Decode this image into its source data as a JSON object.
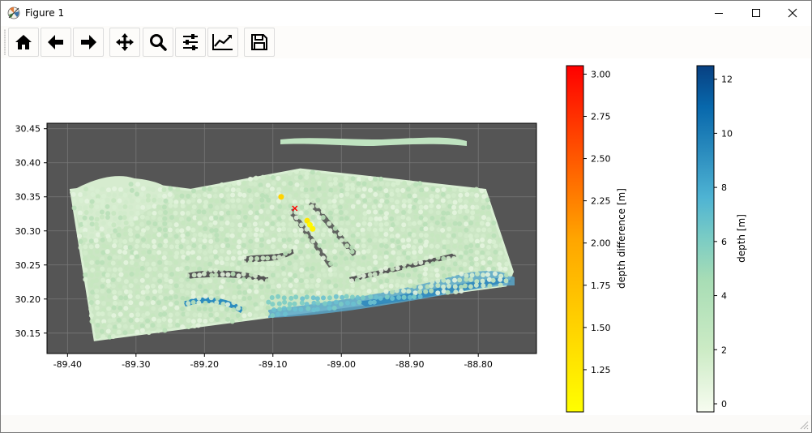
{
  "window": {
    "title": "Figure 1",
    "controls": [
      "minimize",
      "maximize",
      "close"
    ]
  },
  "toolbar": {
    "buttons": [
      {
        "name": "home",
        "icon": "home-icon"
      },
      {
        "name": "back",
        "icon": "arrow-left-icon"
      },
      {
        "name": "forward",
        "icon": "arrow-right-icon"
      },
      {
        "name": "pan",
        "icon": "move-icon"
      },
      {
        "name": "zoom",
        "icon": "magnifier-icon"
      },
      {
        "name": "configure-subplots",
        "icon": "sliders-icon"
      },
      {
        "name": "edit-axis",
        "icon": "line-chart-icon"
      },
      {
        "name": "save",
        "icon": "floppy-disk-icon"
      }
    ]
  },
  "chart_data": [
    {
      "type": "scatter",
      "title": "",
      "xlabel": "",
      "ylabel": "",
      "xlim": [
        -89.43,
        -88.715
      ],
      "ylim": [
        30.12,
        30.458
      ],
      "x_ticks": [
        -89.4,
        -89.3,
        -89.2,
        -89.1,
        -89.0,
        -88.9,
        -88.8
      ],
      "x_tick_labels": [
        "-89.40",
        "-89.30",
        "-89.20",
        "-89.10",
        "-89.00",
        "-88.90",
        "-88.80"
      ],
      "y_ticks": [
        30.15,
        30.2,
        30.25,
        30.3,
        30.35,
        30.4,
        30.45
      ],
      "y_tick_labels": [
        "30.15",
        "30.20",
        "30.25",
        "30.30",
        "30.35",
        "30.40",
        "30.45"
      ],
      "grid": true,
      "background": "#555555",
      "survey_region": {
        "outline": [
          [
            -89.395,
            30.36
          ],
          [
            -89.36,
            30.14
          ],
          [
            -88.76,
            30.22
          ],
          [
            -88.75,
            30.24
          ],
          [
            -88.79,
            30.36
          ],
          [
            -89.06,
            30.39
          ],
          [
            -89.22,
            30.36
          ],
          [
            -89.3,
            30.37
          ]
        ],
        "depth_range": [
          0,
          12
        ]
      },
      "difference_points": [
        {
          "x": -89.05,
          "y": 30.315,
          "value": 1.2
        },
        {
          "x": -89.046,
          "y": 30.309,
          "value": 1.05
        },
        {
          "x": -89.042,
          "y": 30.303,
          "value": 1.1
        },
        {
          "x": -89.088,
          "y": 30.35,
          "value": 1.35
        }
      ],
      "marker": {
        "x": -89.068,
        "y": 30.333,
        "symbol": "x",
        "color": "#ff0000"
      }
    },
    {
      "type": "heatmap",
      "title": "",
      "ylabel": "depth difference [m]",
      "ylim": [
        1.0,
        3.05
      ],
      "ticks": [
        1.25,
        1.5,
        1.75,
        2.0,
        2.25,
        2.5,
        2.75,
        3.0
      ],
      "tick_labels": [
        "1.25",
        "1.50",
        "1.75",
        "2.00",
        "2.25",
        "2.50",
        "2.75",
        "3.00"
      ],
      "colors": [
        "#ffff00",
        "#ffa500",
        "#ff0000"
      ]
    },
    {
      "type": "heatmap",
      "title": "",
      "ylabel": "depth [m]",
      "ylim": [
        -0.3,
        12.5
      ],
      "ticks": [
        0,
        2,
        4,
        6,
        8,
        10,
        12
      ],
      "tick_labels": [
        "0",
        "2",
        "4",
        "6",
        "8",
        "10",
        "12"
      ],
      "colors": [
        "#f7fcf0",
        "#ccebc5",
        "#7bccc4",
        "#4eb3d3",
        "#2b8cbe",
        "#0868ac",
        "#084081"
      ]
    }
  ]
}
